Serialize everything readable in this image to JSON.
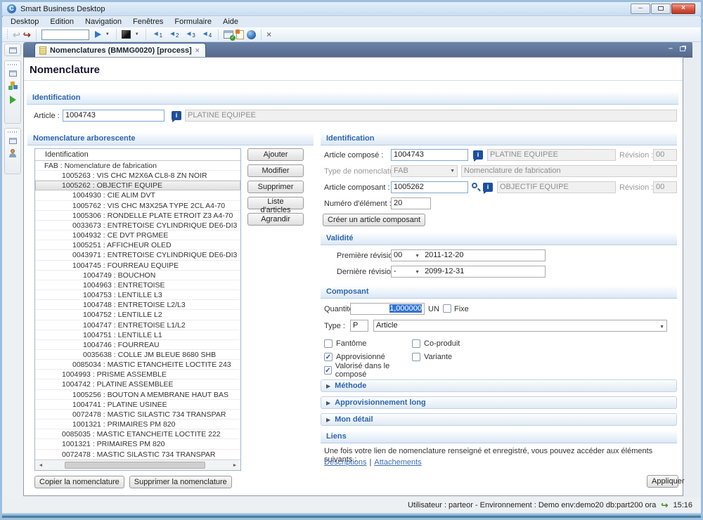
{
  "window": {
    "title": "Smart Business Desktop",
    "status_text": "Utilisateur : parteor - Environnement : Demo env:demo20 db:part200 ora",
    "time": "15:16"
  },
  "menu": {
    "items": [
      "Desktop",
      "Edition",
      "Navigation",
      "Fenêtres",
      "Formulaire",
      "Aide"
    ]
  },
  "toolbar": {
    "nav_numbers": [
      "1",
      "2",
      "3",
      "4"
    ]
  },
  "tab": {
    "title": "Nomenclatures (BMMG0020) [process]"
  },
  "page": {
    "title": "Nomenclature"
  },
  "top_identification": {
    "section_title": "Identification",
    "article_label": "Article :",
    "article_value": "1004743",
    "article_description": "PLATINE EQUIPEE"
  },
  "tree_panel": {
    "section_title": "Nomenclature arborescente",
    "column_header": "Identification",
    "rows": [
      {
        "text": "FAB : Nomenclature de fabrication",
        "level": 0,
        "selected": false
      },
      {
        "text": "1005263 : VIS CHC M2X6A CL8-8 ZN NOIR",
        "level": 1,
        "selected": false
      },
      {
        "text": "1005262 : OBJECTIF EQUIPE",
        "level": 1,
        "selected": true
      },
      {
        "text": "1004930 : CIE ALIM DVT",
        "level": 2,
        "selected": false
      },
      {
        "text": "1005762 : VIS CHC M3X25A TYPE 2CL A4-70",
        "level": 2,
        "selected": false
      },
      {
        "text": "1005306 : RONDELLE PLATE ETROIT Z3 A4-70",
        "level": 2,
        "selected": false
      },
      {
        "text": "0033673 : ENTRETOISE CYLINDRIQUE DE6-DI3",
        "level": 2,
        "selected": false
      },
      {
        "text": "1004932 : CE DVT PRGMEE",
        "level": 2,
        "selected": false
      },
      {
        "text": "1005251 : AFFICHEUR OLED",
        "level": 2,
        "selected": false
      },
      {
        "text": "0043971 : ENTRETOISE CYLINDRIQUE DE6-DI3",
        "level": 2,
        "selected": false
      },
      {
        "text": "1004745 : FOURREAU EQUIPE",
        "level": 2,
        "selected": false
      },
      {
        "text": "1004749 : BOUCHON",
        "level": 3,
        "selected": false
      },
      {
        "text": "1004963 : ENTRETOISE",
        "level": 3,
        "selected": false
      },
      {
        "text": "1004753 : LENTILLE L3",
        "level": 3,
        "selected": false
      },
      {
        "text": "1004748 : ENTRETOISE L2/L3",
        "level": 3,
        "selected": false
      },
      {
        "text": "1004752 : LENTILLE L2",
        "level": 3,
        "selected": false
      },
      {
        "text": "1004747 : ENTRETOISE L1/L2",
        "level": 3,
        "selected": false
      },
      {
        "text": "1004751 : LENTILLE L1",
        "level": 3,
        "selected": false
      },
      {
        "text": "1004746 : FOURREAU",
        "level": 3,
        "selected": false
      },
      {
        "text": "0035638 : COLLE JM BLEUE 8680 SHB",
        "level": 3,
        "selected": false
      },
      {
        "text": "0085034 : MASTIC ETANCHEITE LOCTITE 243",
        "level": 2,
        "selected": false
      },
      {
        "text": "1004993 : PRISME ASSEMBLE",
        "level": 1,
        "selected": false
      },
      {
        "text": "1004742 : PLATINE ASSEMBLEE",
        "level": 1,
        "selected": false
      },
      {
        "text": "1005256 : BOUTON A MEMBRANE HAUT BAS",
        "level": 2,
        "selected": false
      },
      {
        "text": "1004741 : PLATINE USINEE",
        "level": 2,
        "selected": false
      },
      {
        "text": "0072478 : MASTIC SILASTIC 734 TRANSPAR",
        "level": 2,
        "selected": false
      },
      {
        "text": "1001321 : PRIMAIRES PM 820",
        "level": 2,
        "selected": false
      },
      {
        "text": "0085035 : MASTIC ETANCHEITE LOCTITE 222",
        "level": 1,
        "selected": false
      },
      {
        "text": "1001321 : PRIMAIRES PM 820",
        "level": 1,
        "selected": false
      },
      {
        "text": "0072478 : MASTIC SILASTIC 734 TRANSPAR",
        "level": 1,
        "selected": false
      }
    ],
    "action_buttons": [
      "Ajouter",
      "Modifier",
      "Supprimer",
      "Liste d'articles",
      "Agrandir"
    ],
    "footer_buttons": [
      "Copier la nomenclature",
      "Supprimer la nomenclature"
    ]
  },
  "detail": {
    "identification": {
      "section_title": "Identification",
      "article_compose_label": "Article composé :",
      "article_compose_value": "1004743",
      "article_compose_description": "PLATINE EQUIPEE",
      "revision_label": "Révision :",
      "article_compose_revision": "00",
      "type_label": "Type de nomenclature :",
      "type_value": "FAB",
      "type_description": "Nomenclature de fabrication",
      "article_composant_label": "Article composant :",
      "article_composant_value": "1005262",
      "article_composant_description": "OBJECTIF EQUIPE",
      "article_composant_revision": "00",
      "numero_element_label": "Numéro d'élément :",
      "numero_element_value": "20",
      "create_button": "Créer un article composant"
    },
    "validite": {
      "section_title": "Validité",
      "premiere_label": "Première révision :",
      "premiere_revision": "00",
      "premiere_date": "2011-12-20",
      "derniere_label": "Dernière révision :",
      "derniere_revision": "-",
      "derniere_date": "2099-12-31"
    },
    "composant": {
      "section_title": "Composant",
      "quantite_label": "Quantité :",
      "quantite_value": "1,000000",
      "unit": "UN",
      "fixe_label": "Fixe",
      "fixe_checked": false,
      "type_label": "Type :",
      "type_code": "P",
      "type_value": "Article",
      "checkboxes": [
        {
          "label": "Fantôme",
          "checked": false
        },
        {
          "label": "Co-produit",
          "checked": false
        },
        {
          "label": "Approvisionné",
          "checked": true
        },
        {
          "label": "Variante",
          "checked": false
        },
        {
          "label": "Valorisé dans le composé",
          "checked": true
        }
      ]
    },
    "collapsed_sections": [
      "Méthode",
      "Approvisionnement long",
      "Mon détail"
    ],
    "liens": {
      "section_title": "Liens",
      "text": "Une fois votre lien de nomenclature renseigné et enregistré, vous pouvez accéder aux éléments suivants :",
      "links": [
        "Descriptions",
        "Attachements"
      ],
      "separator": "|"
    },
    "apply_button": "Appliquer"
  },
  "icons": {
    "app_logo": "C",
    "dropdown": "▼",
    "collapsed": "▶",
    "close": "×",
    "minimize": "–",
    "info": "i",
    "check": "✓",
    "scroll_left": "◄",
    "scroll_right": "►",
    "nav_arrow": "◄",
    "undo": "↩",
    "redo": "↪",
    "sync": "↪"
  },
  "colors": {
    "accent_blue": "#2f66b0",
    "selection_blue": "#3474d0",
    "link_blue": "#3a6cb4",
    "close_red": "#cf4432",
    "tabstrip_blue": "#5b7199"
  }
}
